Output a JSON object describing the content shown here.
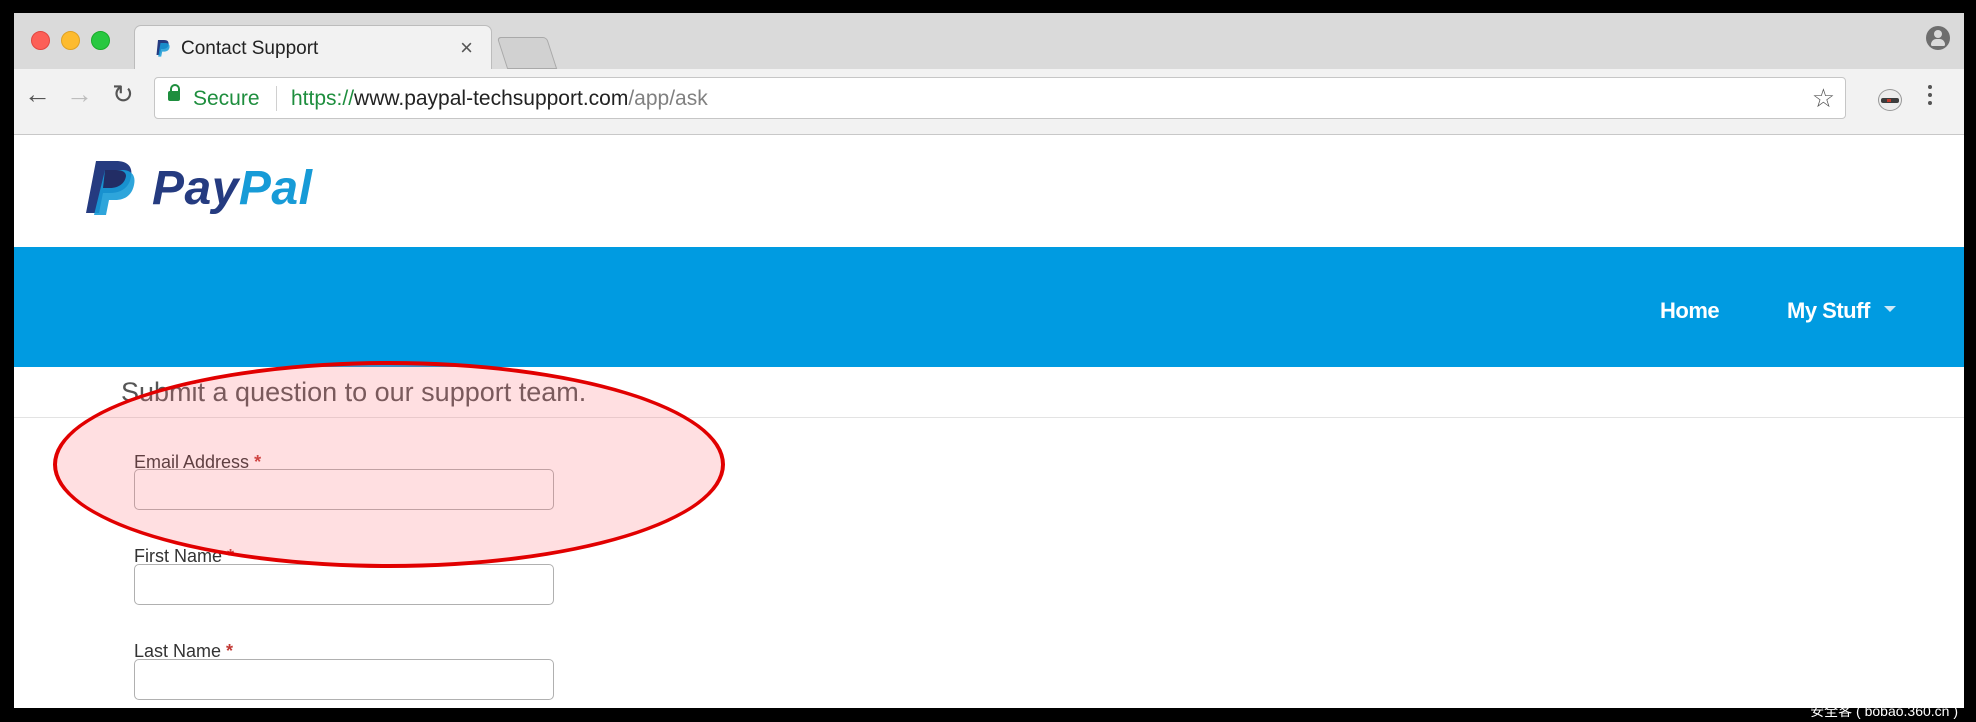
{
  "browser": {
    "tab": {
      "title": "Contact Support",
      "close_label": "×"
    },
    "icons": {
      "back": "arrow-left",
      "forward": "arrow-right",
      "reload": "reload",
      "star": "star-outline",
      "menu": "kebab-menu",
      "profile": "person-circle",
      "extension": "incognito-mask"
    },
    "address_bar": {
      "secure_label": "Secure",
      "url_scheme": "https://",
      "url_host": "www.paypal-techsupport.com",
      "url_path": "/app/ask"
    }
  },
  "site": {
    "logo_pay": "Pay",
    "logo_pal": "Pal",
    "nav": {
      "home": "Home",
      "my_stuff": "My Stuff"
    },
    "colors": {
      "nav_bg": "#009be1",
      "logo_dark": "#253b80",
      "logo_light": "#179bd7",
      "highlight": "#e10000",
      "required": "#c23934"
    }
  },
  "form": {
    "heading": "Submit a question to our support team.",
    "required_mark": "*",
    "fields": [
      {
        "label": "Email Address",
        "value": "",
        "placeholder": ""
      },
      {
        "label": "First Name",
        "value": "",
        "placeholder": ""
      },
      {
        "label": "Last Name",
        "value": "",
        "placeholder": ""
      }
    ]
  },
  "watermark": "安全客 ( bobao.360.cn )"
}
